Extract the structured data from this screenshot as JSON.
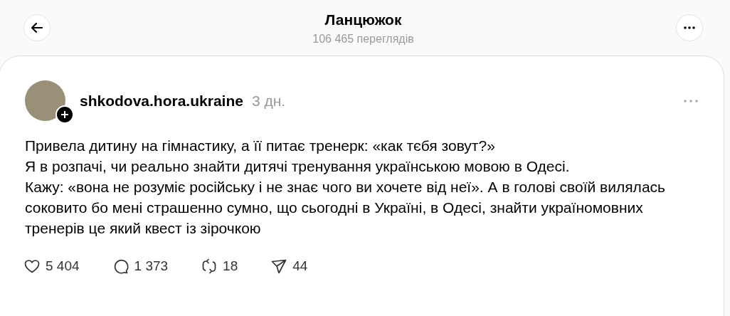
{
  "header": {
    "title": "Ланцюжок",
    "views": "106 465 переглядів"
  },
  "post": {
    "author": "shkodova.hora.ukraine",
    "time": "3 дн.",
    "paragraphs": [
      "Привела дитину на гімнастику, а її питає тренерк: «как тєбя зовут?»",
      "Я в розпачі, чи реально знайти дитячі тренування українською мовою в Одесі.",
      "Кажу: «вона не розуміє російську і не знає чого ви хочете від неї». А в голові своїй вилялась соковито бо мені страшенно сумно, що сьогодні в Україні, в Одесі, знайти україномовних тренерів це який квест із зірочкою"
    ],
    "actions": [
      {
        "kind": "like",
        "count": "5 404"
      },
      {
        "kind": "comment",
        "count": "1 373"
      },
      {
        "kind": "repost",
        "count": "18"
      },
      {
        "kind": "share",
        "count": "44"
      }
    ]
  }
}
